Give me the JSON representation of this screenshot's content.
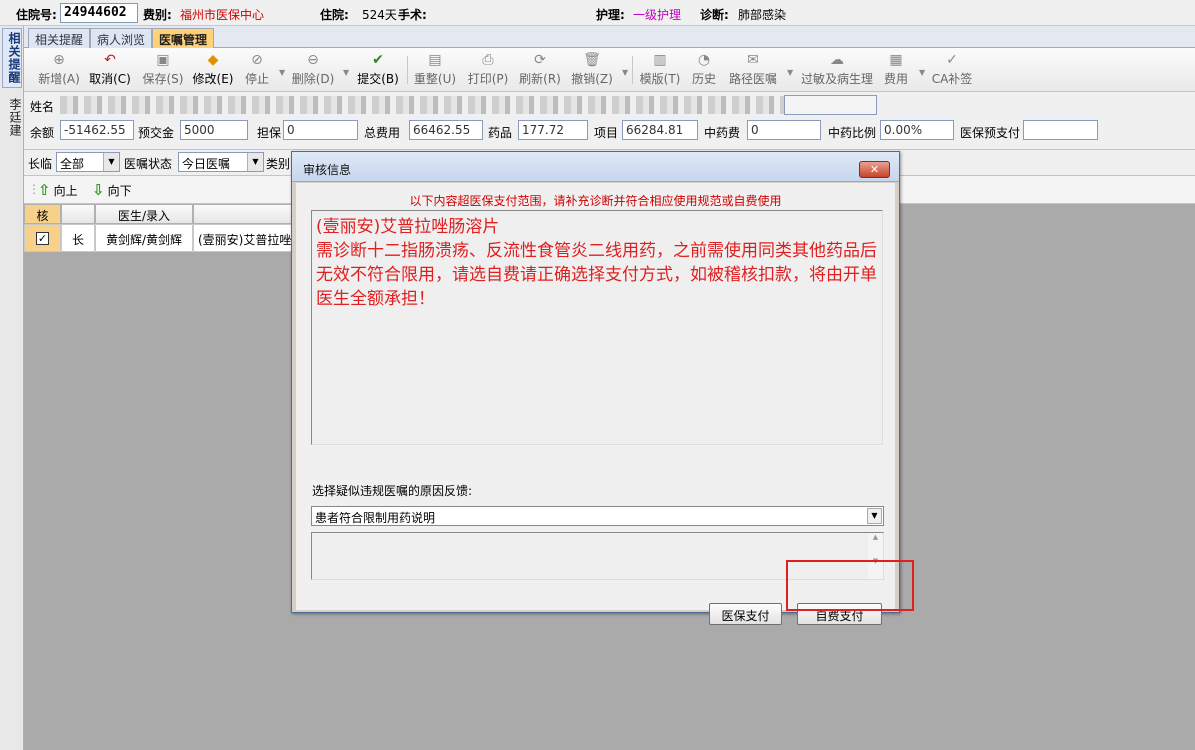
{
  "topbar": {
    "admission_no_label": "住院号:",
    "admission_no": "24944602",
    "fee_type_label": "费别:",
    "fee_type": "福州市医保中心",
    "stay_label": "住院:",
    "stay_days": "524天",
    "surgery_label": "手术:",
    "nursing_label": "护理:",
    "nursing_value": "一级护理",
    "diagnosis_label": "诊断:",
    "diagnosis_value": "肺部感染"
  },
  "leftstrip": {
    "tab_related": "相关提醒",
    "patient_name": "李廷建"
  },
  "tabs": [
    "相关提醒",
    "病人浏览",
    "医嘱管理"
  ],
  "toolbar": {
    "buttons": [
      {
        "label": "新增(A)",
        "icon": "add-icon"
      },
      {
        "label": "取消(C)",
        "icon": "undo-icon"
      },
      {
        "label": "保存(S)",
        "icon": "save-icon"
      },
      {
        "label": "修改(E)",
        "icon": "edit-icon"
      },
      {
        "label": "停止",
        "icon": "stop-icon"
      },
      {
        "label": "删除(D)",
        "icon": "delete-icon"
      },
      {
        "label": "提交(B)",
        "icon": "submit-icon"
      },
      {
        "label": "重整(U)",
        "icon": "reorganize-icon"
      },
      {
        "label": "打印(P)",
        "icon": "print-icon"
      },
      {
        "label": "刷新(R)",
        "icon": "refresh-icon"
      },
      {
        "label": "撤销(Z)",
        "icon": "trash-icon"
      },
      {
        "label": "模版(T)",
        "icon": "template-icon"
      },
      {
        "label": "历史",
        "icon": "history-icon"
      },
      {
        "label": "路径医嘱",
        "icon": "path-icon"
      },
      {
        "label": "过敏及病生理",
        "icon": "allergy-icon"
      },
      {
        "label": "费用",
        "icon": "fee-icon"
      },
      {
        "label": "CA补签",
        "icon": "ca-icon"
      }
    ]
  },
  "form": {
    "name_label": "姓名",
    "balance_label": "余额",
    "balance_value": "-51462.55",
    "prepaid_label": "预交金",
    "prepaid_value": "5000",
    "guarantee_label": "担保",
    "guarantee_value": "0",
    "total_label": "总费用",
    "total_value": "66462.55",
    "drug_label": "药品",
    "drug_value": "177.72",
    "item_label": "项目",
    "item_value": "66284.81",
    "tcm_fee_label": "中药费",
    "tcm_fee_value": "0",
    "tcm_ratio_label": "中药比例",
    "tcm_ratio_value": "0.00%",
    "insurance_prepay_label": "医保预支付",
    "insurance_prepay_value": ""
  },
  "filter": {
    "longterm_label": "长临",
    "longterm_value": "全部",
    "status_label": "医嘱状态",
    "status_value": "今日医嘱",
    "category_label": "类别"
  },
  "updown": {
    "up": "向上",
    "down": "向下"
  },
  "grid": {
    "headers": [
      "核",
      "",
      "医生/录入",
      ""
    ],
    "row": {
      "checked": "✓",
      "type": "长",
      "doctor": "黄剑辉/黄剑辉",
      "item": "(壹丽安)艾普拉唑"
    }
  },
  "dialog": {
    "title": "审核信息",
    "close": "✕",
    "hint": "以下内容超医保支付范围，请补充诊断并符合相应使用规范或自费使用",
    "message_line1": "(壹丽安)艾普拉唑肠溶片",
    "message_line2": "需诊断十二指肠溃疡、反流性食管炎二线用药，之前需使用同类其他药品后无效不符合限用，请选自费请正确选择支付方式，如被稽核扣款，将由开单医生全额承担！",
    "question": "选择疑似违规医嘱的原因反馈:",
    "reason_value": "患者符合限制用药说明",
    "btn_insurance": "医保支付",
    "btn_selfpay": "自费支付"
  }
}
